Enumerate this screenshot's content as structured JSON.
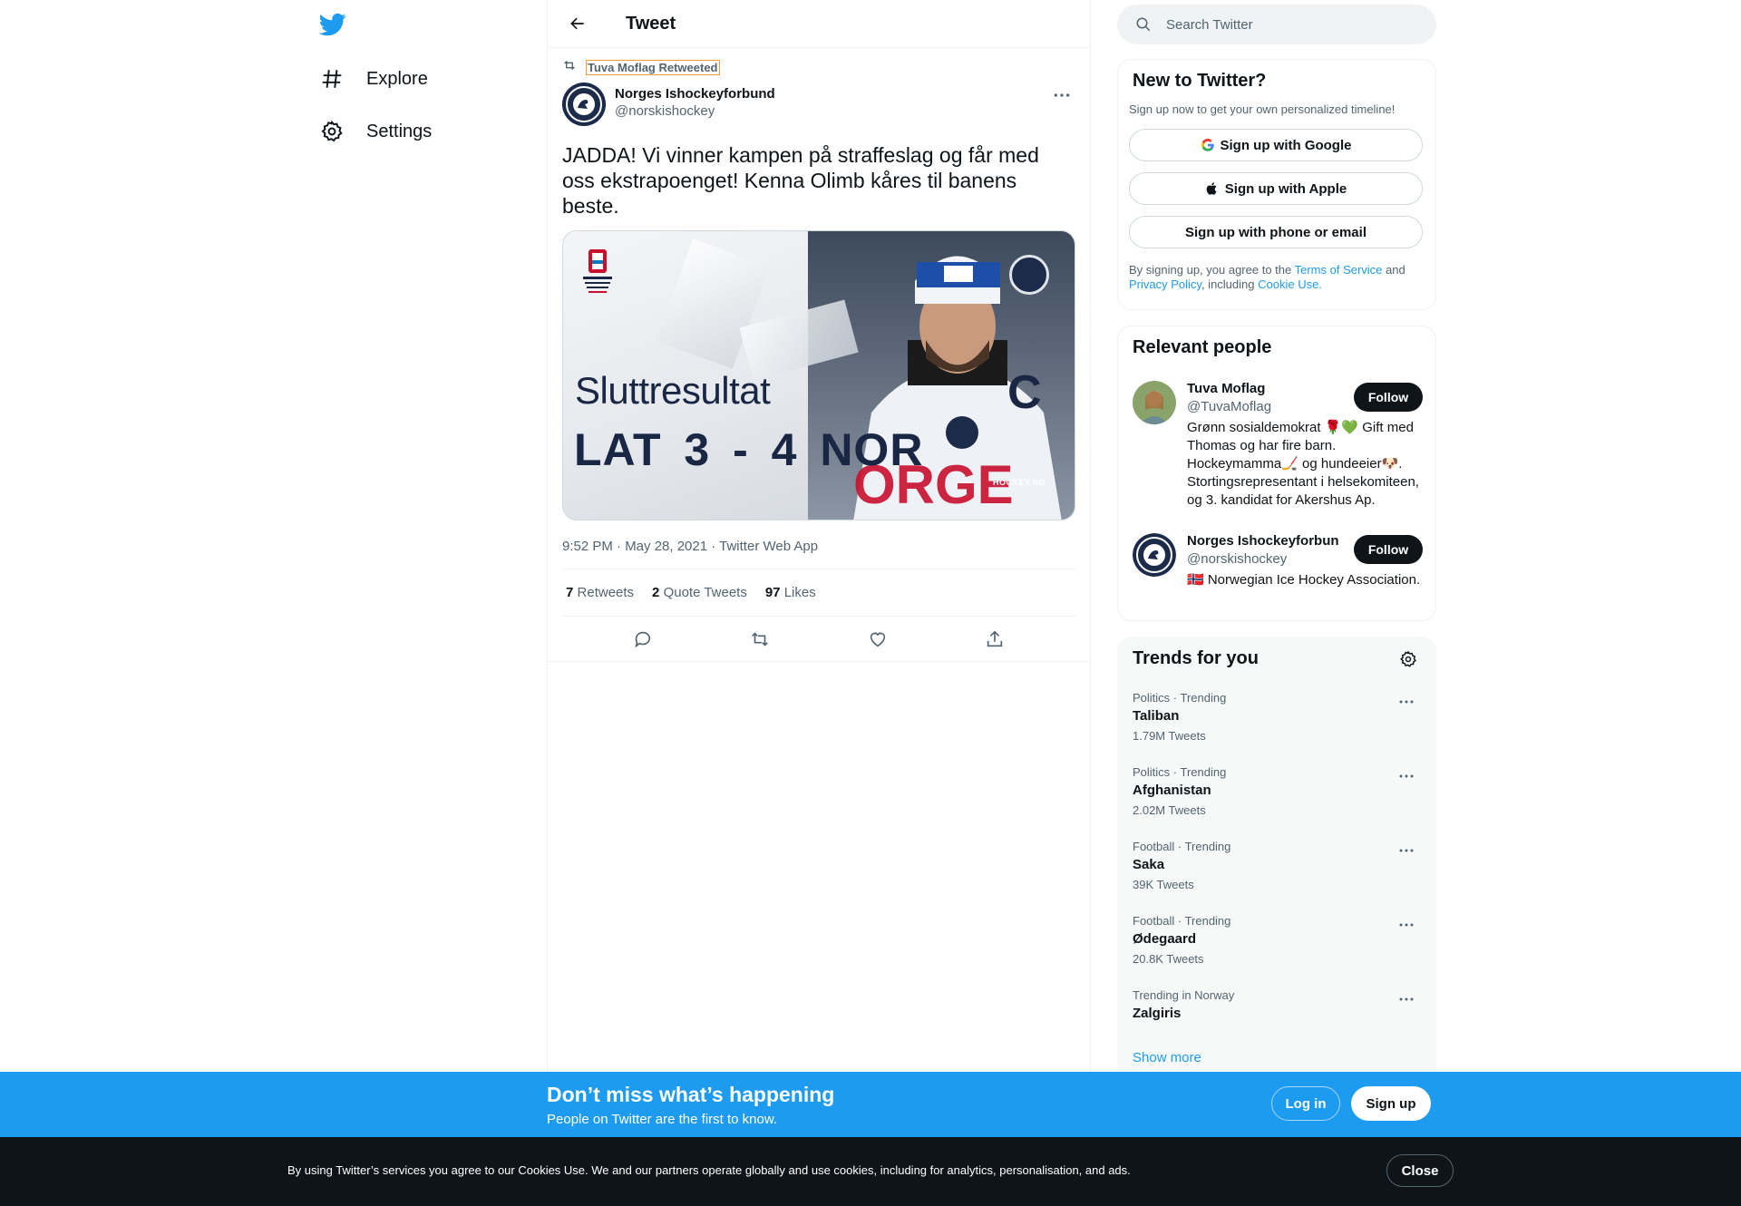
{
  "app": {
    "title": "Tweet"
  },
  "nav": {
    "items": [
      {
        "label": "Explore",
        "icon": "hashtag-icon"
      },
      {
        "label": "Settings",
        "icon": "gear-icon"
      }
    ]
  },
  "header": {
    "title": "Tweet"
  },
  "tweet": {
    "retweeted_by": "Tuva Moflag Retweeted",
    "author_name": "Norges Ishockeyforbund",
    "author_handle": "@norskishockey",
    "text": "JADDA! Vi vinner kampen på straffeslag og får med oss ekstrapoenget! Kenna Olimb kåres til banens beste.",
    "media": {
      "heading": "Sluttresultat",
      "score": "LAT 3 - 4 NOR",
      "watermark": "HOCKEY.NO"
    },
    "meta": "9:52 PM · May 28, 2021 · Twitter Web App",
    "stats": [
      {
        "count": "7",
        "label": "Retweets"
      },
      {
        "count": "2",
        "label": "Quote Tweets"
      },
      {
        "count": "97",
        "label": "Likes"
      }
    ]
  },
  "search": {
    "placeholder": "Search Twitter"
  },
  "new_to_twitter": {
    "title": "New to Twitter?",
    "subtitle": "Sign up now to get your own personalized timeline!",
    "google": "Sign up with Google",
    "apple": "Sign up with Apple",
    "phone": "Sign up with phone or email",
    "terms_prefix": "By signing up, you agree to the ",
    "terms_link": "Terms of Service",
    "terms_and": " and ",
    "privacy_link": "Privacy Policy",
    "including": ", including ",
    "cookie_link": "Cookie Use."
  },
  "relevant": {
    "title": "Relevant people",
    "people": [
      {
        "name": "Tuva Moflag",
        "handle": "@TuvaMoflag",
        "bio": "Grønn sosialdemokrat 🌹💚 Gift med Thomas og har fire barn. Hockeymamma🏒 og hundeeier🐶. Stortingsrepresentant i helsekomiteen, og 3. kandidat for Akershus Ap.",
        "follow": "Follow"
      },
      {
        "name": "Norges Ishockeyforbund",
        "handle": "@norskishockey",
        "bio": "🇳🇴 Norwegian Ice Hockey Association.",
        "follow": "Follow"
      }
    ]
  },
  "trends": {
    "title": "Trends for you",
    "items": [
      {
        "meta": "Politics · Trending",
        "name": "Taliban",
        "count": "1.79M Tweets"
      },
      {
        "meta": "Politics · Trending",
        "name": "Afghanistan",
        "count": "2.02M Tweets"
      },
      {
        "meta": "Football · Trending",
        "name": "Saka",
        "count": "39K Tweets"
      },
      {
        "meta": "Football · Trending",
        "name": "Ødegaard",
        "count": "20.8K Tweets"
      },
      {
        "meta": "Trending in Norway",
        "name": "Zalgiris",
        "count": ""
      }
    ],
    "show_more": "Show more"
  },
  "banner": {
    "title": "Don’t miss what’s happening",
    "subtitle": "People on Twitter are the first to know.",
    "login": "Log in",
    "signup": "Sign up"
  },
  "cookie": {
    "text": "By using Twitter’s services you agree to our Cookies Use. We and our partners operate globally and use cookies, including for analytics, personalisation, and ads.",
    "close": "Close"
  },
  "colors": {
    "brand": "#1d9bf0",
    "text": "#0f1419",
    "secondary": "#536471",
    "dark": "#0f1419"
  }
}
